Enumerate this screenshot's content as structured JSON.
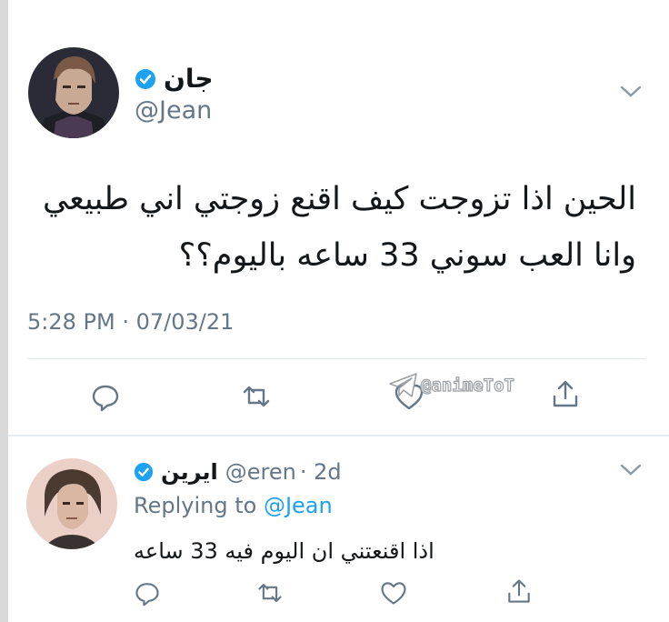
{
  "tweet": {
    "display_name": "جان",
    "handle": "@Jean",
    "text_line1": "الحين اذا تزوجت كيف اقنع زوجتي اني طبيعي",
    "text_line2": "وانا العب سوني 33 ساعه باليوم؟؟",
    "timestamp": "5:28 PM · 07/03/21",
    "actions": [
      "reply-icon",
      "retweet-icon",
      "like-icon",
      "share-icon"
    ]
  },
  "watermark": {
    "text": "@animeToT",
    "icon": "telegram-icon"
  },
  "reply": {
    "display_name": "ايرين",
    "handle": "@eren",
    "age": "· 2d",
    "replying_prefix": "Replying to ",
    "replying_to": "@Jean",
    "text": "اذا اقنعتني ان اليوم فيه 33 ساعه",
    "actions": [
      "reply-icon",
      "retweet-icon",
      "like-icon",
      "share-icon"
    ]
  },
  "colors": {
    "verified": "#1da1f2",
    "link": "#1da1f2",
    "secondary_text": "#657786",
    "icon_gray": "#657786",
    "divider": "#e1e8ed"
  }
}
